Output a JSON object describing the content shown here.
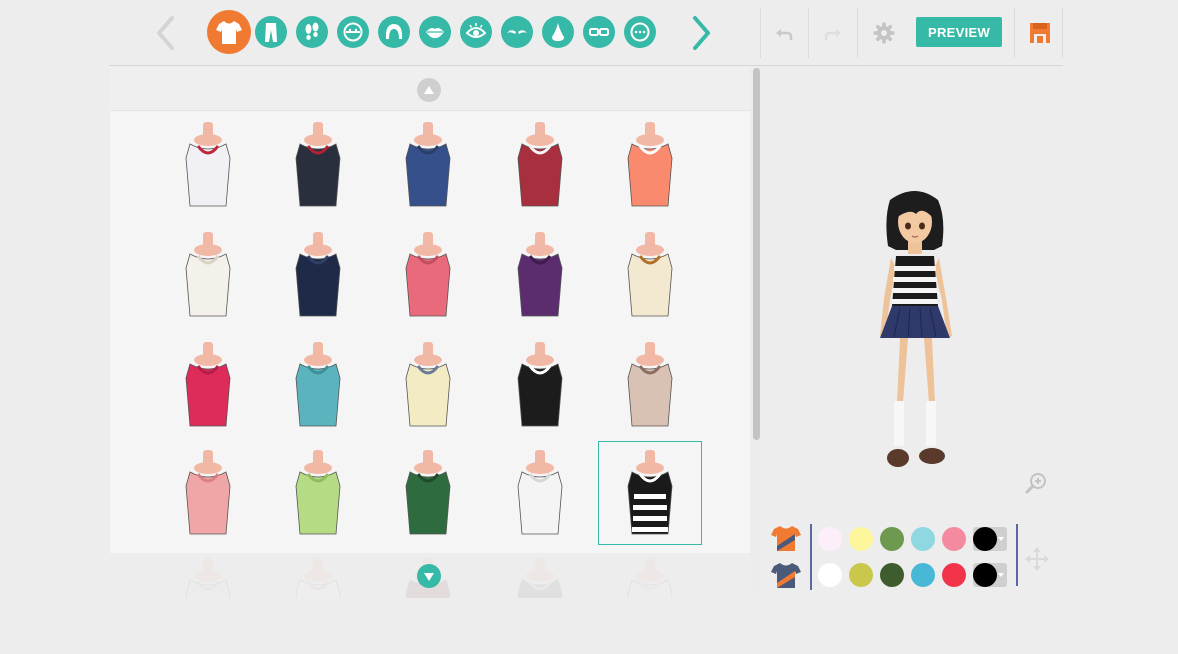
{
  "toolbar": {
    "preview_label": "PREVIEW",
    "categories": [
      {
        "name": "tops",
        "icon": "shirt-icon",
        "active": true
      },
      {
        "name": "bottoms",
        "icon": "pants-icon"
      },
      {
        "name": "shoes",
        "icon": "footprints-icon"
      },
      {
        "name": "face",
        "icon": "face-icon"
      },
      {
        "name": "hair",
        "icon": "hair-icon"
      },
      {
        "name": "mouth",
        "icon": "lips-icon"
      },
      {
        "name": "eyes",
        "icon": "eye-icon"
      },
      {
        "name": "eyebrows",
        "icon": "eyebrows-icon"
      },
      {
        "name": "nose",
        "icon": "nose-icon"
      },
      {
        "name": "glasses",
        "icon": "glasses-icon"
      },
      {
        "name": "more",
        "icon": "dots-icon"
      }
    ]
  },
  "colors": {
    "accent": "#36b9a6",
    "active": "#f07a32",
    "primary_swatches": [
      "#fceffa",
      "#fdf69b",
      "#6e9a50",
      "#8fd8e2",
      "#f48aa0",
      "#000000"
    ],
    "secondary_swatches": [
      "#ffffff",
      "#c9c84c",
      "#3f5c2e",
      "#47b9d6",
      "#f2344b",
      "#000000"
    ]
  },
  "items": [
    {
      "name": "sailor-blouse-red-scarf",
      "body": "#f1f1f5",
      "accent": "#c1273b"
    },
    {
      "name": "black-blazer-red-tie",
      "body": "#2a2f3d",
      "accent": "#b22233"
    },
    {
      "name": "blue-hoodie",
      "body": "#35508a",
      "accent": "#2a3e6a"
    },
    {
      "name": "red-plaid-vest",
      "body": "#a72f3e",
      "accent": "#f3f3f3"
    },
    {
      "name": "coral-collar-top",
      "body": "#f98a6e",
      "accent": "#ffffff"
    },
    {
      "name": "white-sweater",
      "body": "#f3f1ea",
      "accent": "#d8d3c4"
    },
    {
      "name": "navy-tube-top",
      "body": "#1e2a48",
      "accent": "#2f3f66"
    },
    {
      "name": "pink-halter-top",
      "body": "#e86a7b",
      "accent": "#c34e60"
    },
    {
      "name": "purple-tank-top",
      "body": "#5b2d6e",
      "accent": "#3e1a4e"
    },
    {
      "name": "cream-suspenders",
      "body": "#f3e9d0",
      "accent": "#b3702a"
    },
    {
      "name": "pink-tee",
      "body": "#dd2b5a",
      "accent": "#b51e46"
    },
    {
      "name": "teal-peplum-top",
      "body": "#5ab3bd",
      "accent": "#3e8f9a"
    },
    {
      "name": "cream-sweater-vest",
      "body": "#f2ebc4",
      "accent": "#6a7a9a"
    },
    {
      "name": "black-bustier",
      "body": "#1c1c1c",
      "accent": "#ffffff"
    },
    {
      "name": "beige-sweater-vest",
      "body": "#d9c2b3",
      "accent": "#8a6e62"
    },
    {
      "name": "pink-ruffle-blouse",
      "body": "#f0a6a6",
      "accent": "#d97e84"
    },
    {
      "name": "green-tee",
      "body": "#b5db85",
      "accent": "#8fbd5c"
    },
    {
      "name": "green-polo",
      "body": "#2e6b3e",
      "accent": "#1d4b29"
    },
    {
      "name": "white-camisole",
      "body": "#f4f4f4",
      "accent": "#d6d6d6"
    },
    {
      "name": "striped-tank-top",
      "body": "#1a1a1a",
      "accent": "#ffffff",
      "selected": true
    },
    {
      "name": "grey-sailor-blouse",
      "body": "#e8e8ee",
      "accent": "#9aa0ad"
    },
    {
      "name": "pink-white-top",
      "body": "#ffffff",
      "accent": "#f08fb0"
    },
    {
      "name": "maroon-graphic-tee",
      "body": "#7c2e3c",
      "accent": "#5e1f2b"
    },
    {
      "name": "grey-sailor-top",
      "body": "#5c5c66",
      "accent": "#c9c9d1"
    },
    {
      "name": "white-blouse",
      "body": "#f3f3f3",
      "accent": "#c4c4c4"
    }
  ]
}
